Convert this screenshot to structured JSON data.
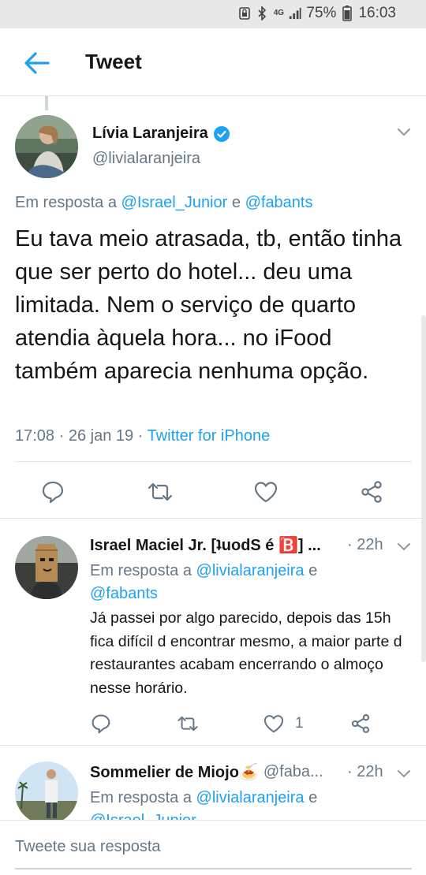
{
  "status_bar": {
    "network": "4G",
    "battery": "75%",
    "time": "16:03"
  },
  "header": {
    "title": "Tweet"
  },
  "main_tweet": {
    "display_name": "Lívia Laranjeira",
    "handle": "@livialaranjeira",
    "reply_prefix": "Em resposta a",
    "mention_1": "@Israel_Junior",
    "conj": "e",
    "mention_2": "@fabants",
    "text": "Eu tava meio atrasada, tb, então tinha que ser perto do hotel... deu uma limitada. Nem o serviço de quarto atendia àquela hora... no iFood também aparecia nenhuma opção.",
    "time": "17:08",
    "date": "26 jan 19",
    "source": "Twitter for iPhone"
  },
  "replies": [
    {
      "display_name": "Israel Maciel Jr. [ʇuodS é 🅱️] ...",
      "handle": "",
      "time": "· 22h",
      "reply_prefix": "Em resposta a",
      "mention_1": "@livialaranjeira",
      "conj": "e",
      "mention_2": "@fabants",
      "text": "Já passei por algo parecido, depois das 15h fica difícil d encontrar mesmo, a maior parte d restaurantes acabam encerrando o almoço nesse horário.",
      "like_count": "1"
    },
    {
      "display_name": "Sommelier de Miojo🍝",
      "handle": "@faba...",
      "time": "· 22h",
      "reply_prefix": "Em resposta a",
      "mention_1": "@livialaranjeira",
      "conj": "e",
      "mention_2": "@Israel_Junior"
    }
  ],
  "compose": {
    "placeholder": "Tweete sua resposta"
  },
  "colors": {
    "accent": "#1da1f2",
    "secondary_text": "#657786",
    "divider": "#e1e8ed",
    "verified": "#1da1f2"
  },
  "icons": [
    "back-arrow-icon",
    "verified-badge-icon",
    "chevron-down-icon",
    "reply-icon",
    "retweet-icon",
    "like-icon",
    "share-icon"
  ]
}
